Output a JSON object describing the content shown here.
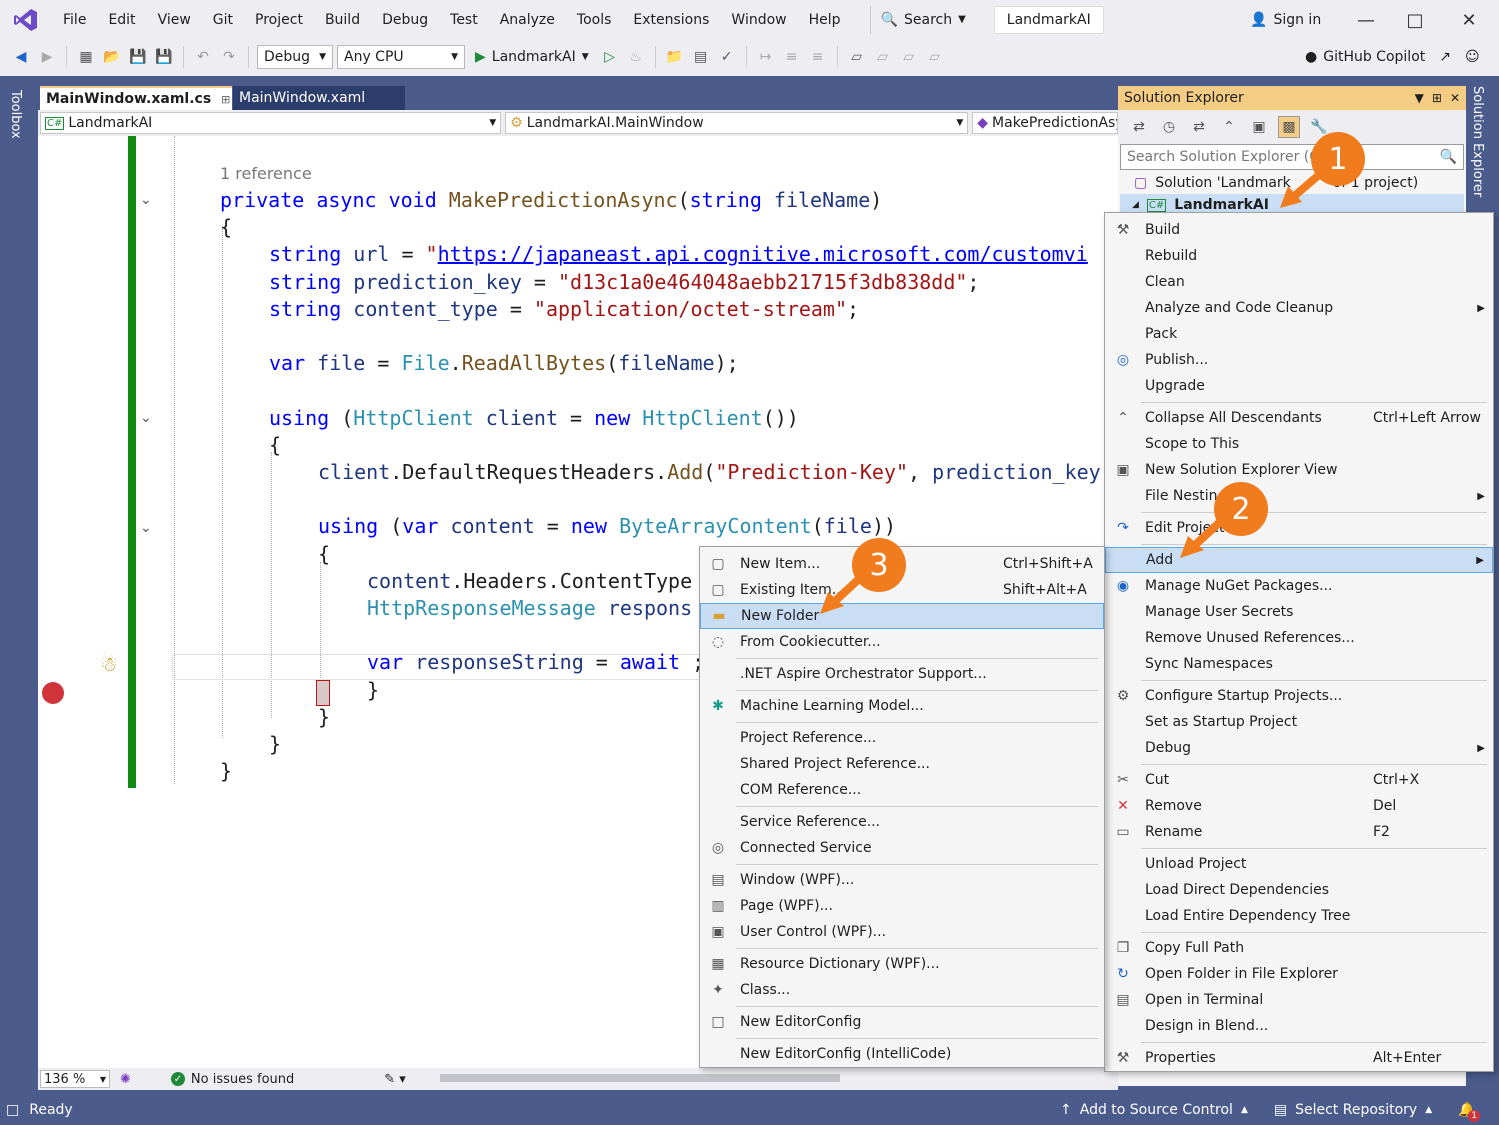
{
  "menu": [
    "File",
    "Edit",
    "View",
    "Git",
    "Project",
    "Build",
    "Debug",
    "Test",
    "Analyze",
    "Tools",
    "Extensions",
    "Window",
    "Help"
  ],
  "search_label": "Search",
  "app_title": "LandmarkAI",
  "signin_label": "Sign in",
  "toolbar": {
    "config": "Debug",
    "platform": "Any CPU",
    "run_target": "LandmarkAI",
    "copilot": "GitHub Copilot"
  },
  "tabs": [
    {
      "label": "MainWindow.xaml.cs",
      "active": true
    },
    {
      "label": "MainWindow.xaml",
      "active": false
    }
  ],
  "navbar": {
    "project": "LandmarkAI",
    "type": "LandmarkAI.MainWindow",
    "member": "MakePredictionAsy"
  },
  "code": {
    "ref_count": "1 reference",
    "lines": [
      {
        "indent": 0,
        "tokens": [
          [
            "kw",
            "private "
          ],
          [
            "kw",
            "async "
          ],
          [
            "kw",
            "void "
          ],
          [
            "mth",
            "MakePredictionAsync"
          ],
          [
            "",
            "("
          ],
          [
            "kw",
            "string "
          ],
          [
            "var",
            "fileName"
          ],
          [
            "",
            ")"
          ]
        ]
      },
      {
        "indent": 0,
        "tokens": [
          [
            "",
            "{"
          ]
        ]
      },
      {
        "indent": 1,
        "tokens": [
          [
            "kw",
            "string "
          ],
          [
            "var",
            "url"
          ],
          [
            "",
            " = "
          ],
          [
            "str",
            "\""
          ],
          [
            "link",
            "https://japaneast.api.cognitive.microsoft.com/customvi"
          ]
        ]
      },
      {
        "indent": 1,
        "tokens": [
          [
            "kw",
            "string "
          ],
          [
            "var",
            "prediction_key"
          ],
          [
            "",
            " = "
          ],
          [
            "str",
            "\"d13c1a0e464048aebb21715f3db838dd\""
          ],
          [
            "",
            ";"
          ]
        ]
      },
      {
        "indent": 1,
        "tokens": [
          [
            "kw",
            "string "
          ],
          [
            "var",
            "content_type"
          ],
          [
            "",
            " = "
          ],
          [
            "str",
            "\"application/octet-stream\""
          ],
          [
            "",
            ";"
          ]
        ]
      },
      {
        "indent": 1,
        "tokens": []
      },
      {
        "indent": 1,
        "tokens": [
          [
            "kw",
            "var "
          ],
          [
            "var",
            "file"
          ],
          [
            "",
            " = "
          ],
          [
            "ty",
            "File"
          ],
          [
            "",
            "."
          ],
          [
            "mth",
            "ReadAllBytes"
          ],
          [
            "",
            "("
          ],
          [
            "var",
            "fileName"
          ],
          [
            "",
            ");"
          ]
        ]
      },
      {
        "indent": 1,
        "tokens": []
      },
      {
        "indent": 1,
        "tokens": [
          [
            "kw",
            "using "
          ],
          [
            "",
            "("
          ],
          [
            "ty",
            "HttpClient "
          ],
          [
            "var",
            "client"
          ],
          [
            "",
            " = "
          ],
          [
            "kw",
            "new "
          ],
          [
            "ty",
            "HttpClient"
          ],
          [
            "",
            "())"
          ]
        ]
      },
      {
        "indent": 1,
        "tokens": [
          [
            "",
            "{"
          ]
        ]
      },
      {
        "indent": 2,
        "tokens": [
          [
            "var",
            "client"
          ],
          [
            "",
            "."
          ],
          [
            "",
            "DefaultRequestHeaders"
          ],
          [
            "",
            "."
          ],
          [
            "mth",
            "Add"
          ],
          [
            "",
            "("
          ],
          [
            "str",
            "\"Prediction-Key\""
          ],
          [
            "",
            ", "
          ],
          [
            "var",
            "prediction_key"
          ]
        ]
      },
      {
        "indent": 2,
        "tokens": []
      },
      {
        "indent": 2,
        "tokens": [
          [
            "kw",
            "using "
          ],
          [
            "",
            "("
          ],
          [
            "kw",
            "var "
          ],
          [
            "var",
            "content"
          ],
          [
            "",
            " = "
          ],
          [
            "kw",
            "new "
          ],
          [
            "ty",
            "ByteArrayContent"
          ],
          [
            "",
            "("
          ],
          [
            "var",
            "file"
          ],
          [
            "",
            "))"
          ]
        ]
      },
      {
        "indent": 2,
        "tokens": [
          [
            "",
            "{"
          ]
        ]
      },
      {
        "indent": 3,
        "tokens": [
          [
            "var",
            "content"
          ],
          [
            "",
            "."
          ],
          [
            "",
            "Headers"
          ],
          [
            "",
            "."
          ],
          [
            "",
            "ContentType"
          ]
        ]
      },
      {
        "indent": 3,
        "tokens": [
          [
            "ty",
            "HttpResponseMessage "
          ],
          [
            "var",
            "respons"
          ]
        ]
      },
      {
        "indent": 3,
        "tokens": []
      },
      {
        "indent": 3,
        "tokens": [
          [
            "kw",
            "var "
          ],
          [
            "var",
            "responseString"
          ],
          [
            "",
            " = "
          ],
          [
            "kw",
            "await "
          ],
          [
            "",
            ";"
          ]
        ]
      },
      {
        "indent": 3,
        "tokens": [
          [
            "",
            "}"
          ]
        ]
      },
      {
        "indent": 2,
        "tokens": [
          [
            "",
            "}"
          ]
        ]
      },
      {
        "indent": 1,
        "tokens": [
          [
            "",
            "}"
          ]
        ]
      },
      {
        "indent": 0,
        "tokens": [
          [
            "",
            "}"
          ]
        ]
      }
    ]
  },
  "editor_status": {
    "zoom": "136 %",
    "issues": "No issues found"
  },
  "solution_explorer": {
    "title": "Solution Explorer",
    "search_placeholder": "Search Solution Explorer (Ctrl",
    "solution_label": "Solution 'Landmark",
    "solution_suffix": "of 1 project)",
    "project_label": "LandmarkAI"
  },
  "project_menu": [
    {
      "label": "Build",
      "icon": "build-icon"
    },
    {
      "label": "Rebuild"
    },
    {
      "label": "Clean"
    },
    {
      "label": "Analyze and Code Cleanup",
      "submenu": true
    },
    {
      "label": "Pack"
    },
    {
      "label": "Publish...",
      "icon": "globe-icon"
    },
    {
      "label": "Upgrade"
    },
    {
      "sep": true
    },
    {
      "label": "Collapse All Descendants",
      "shortcut": "Ctrl+Left Arrow",
      "icon": "collapse-icon"
    },
    {
      "label": "Scope to This"
    },
    {
      "label": "New Solution Explorer View",
      "icon": "new-view-icon"
    },
    {
      "label": "File Nesting",
      "submenu": true
    },
    {
      "sep": true
    },
    {
      "label": "Edit Project File",
      "icon": "edit-icon"
    },
    {
      "sep": true
    },
    {
      "label": "Add",
      "submenu": true,
      "highlight": true
    },
    {
      "label": "Manage NuGet Packages...",
      "icon": "nuget-icon"
    },
    {
      "label": "Manage User Secrets"
    },
    {
      "label": "Remove Unused References..."
    },
    {
      "label": "Sync Namespaces"
    },
    {
      "sep": true
    },
    {
      "label": "Configure Startup Projects...",
      "icon": "settings-icon"
    },
    {
      "label": "Set as Startup Project"
    },
    {
      "label": "Debug",
      "submenu": true
    },
    {
      "sep": true
    },
    {
      "label": "Cut",
      "shortcut": "Ctrl+X",
      "icon": "cut-icon"
    },
    {
      "label": "Remove",
      "shortcut": "Del",
      "icon": "remove-icon"
    },
    {
      "label": "Rename",
      "shortcut": "F2",
      "icon": "rename-icon"
    },
    {
      "sep": true
    },
    {
      "label": "Unload Project"
    },
    {
      "label": "Load Direct Dependencies"
    },
    {
      "label": "Load Entire Dependency Tree"
    },
    {
      "sep": true
    },
    {
      "label": "Copy Full Path",
      "icon": "copy-icon"
    },
    {
      "label": "Open Folder in File Explorer",
      "icon": "open-folder-icon"
    },
    {
      "label": "Open in Terminal",
      "icon": "terminal-icon"
    },
    {
      "label": "Design in Blend..."
    },
    {
      "sep": true
    },
    {
      "label": "Properties",
      "shortcut": "Alt+Enter",
      "icon": "wrench-icon"
    }
  ],
  "add_menu": [
    {
      "label": "New Item...",
      "shortcut": "Ctrl+Shift+A",
      "icon": "new-item-icon"
    },
    {
      "label": "Existing Item...",
      "shortcut": "Shift+Alt+A",
      "icon": "existing-item-icon"
    },
    {
      "label": "New Folder",
      "highlight": true,
      "icon": "folder-icon"
    },
    {
      "label": "From Cookiecutter...",
      "icon": "cookiecutter-icon"
    },
    {
      "sep": true
    },
    {
      "label": ".NET Aspire Orchestrator Support..."
    },
    {
      "sep": true
    },
    {
      "label": "Machine Learning Model...",
      "icon": "ml-icon"
    },
    {
      "sep": true
    },
    {
      "label": "Project Reference..."
    },
    {
      "label": "Shared Project Reference..."
    },
    {
      "label": "COM Reference..."
    },
    {
      "sep": true
    },
    {
      "label": "Service Reference..."
    },
    {
      "label": "Connected Service",
      "icon": "connected-service-icon"
    },
    {
      "sep": true
    },
    {
      "label": "Window (WPF)...",
      "icon": "window-icon"
    },
    {
      "label": "Page (WPF)...",
      "icon": "page-icon"
    },
    {
      "label": "User Control (WPF)...",
      "icon": "user-control-icon"
    },
    {
      "sep": true
    },
    {
      "label": "Resource Dictionary (WPF)...",
      "icon": "resource-dictionary-icon"
    },
    {
      "label": "Class...",
      "icon": "class-icon"
    },
    {
      "sep": true
    },
    {
      "label": "New EditorConfig",
      "icon": "editorconfig-icon"
    },
    {
      "sep": true
    },
    {
      "label": "New EditorConfig (IntelliCode)"
    }
  ],
  "callouts": [
    "1",
    "2",
    "3"
  ],
  "statusbar": {
    "ready": "Ready",
    "source_control": "Add to Source Control",
    "repository": "Select Repository",
    "notifications": "1"
  },
  "colors": {
    "frame": "#4a5b8c",
    "callout": "#f07c1e",
    "highlight": "#c9def5",
    "change_bar": "#108a10",
    "breakpoint": "#d1343b",
    "panel_title": "#f5cc84"
  }
}
